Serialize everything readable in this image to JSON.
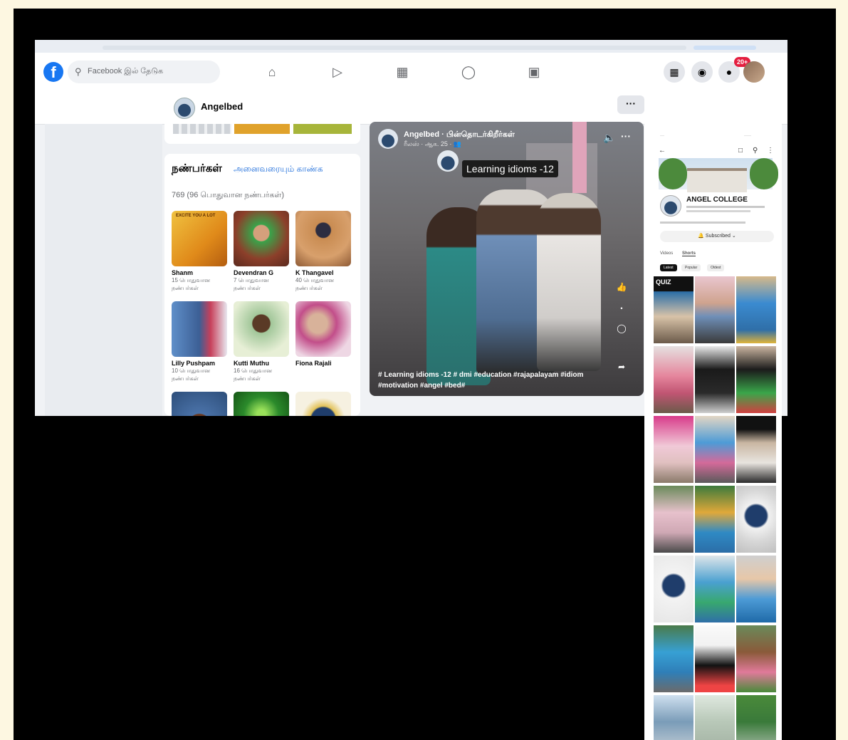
{
  "search": {
    "placeholder": "Facebook இல் தேடுக"
  },
  "badge": "20+",
  "page": {
    "name": "Angelbed"
  },
  "friends": {
    "title": "நண்பர்கள்",
    "see_all": "அனைவரையும் காண்க",
    "count": "769 (96 பொதுவான நண்பர்கள்)",
    "items": [
      {
        "name": "Shanm",
        "mutual": "15 பொதுவான நண்பர்கள்"
      },
      {
        "name": "Devendran G",
        "mutual": "7 பொதுவான நண்பர்கள்"
      },
      {
        "name": "K Thangavel",
        "mutual": "40 பொதுவான நண்பர்கள்"
      },
      {
        "name": "Lilly Pushpam",
        "mutual": "10 பொதுவான நண்பர்கள்"
      },
      {
        "name": "Kutti Muthu",
        "mutual": "16 பொதுவான நண்பர்கள்"
      },
      {
        "name": "Fiona Rajali",
        "mutual": ""
      }
    ],
    "card1_text": "EXCITE YOU A LOT"
  },
  "post": {
    "author": "Angelbed · பின்தொடர்கிறீர்கள்",
    "meta": "ரீலஸ் · ஆக. 25 · 👥",
    "overlay": "Learning idioms -12",
    "caption": "# Learning idioms -12 # dmi #education #rajapalayam #idiom #motivation #angel #bed#"
  },
  "phone": {
    "channel": "ANGEL COLLEGE",
    "subscribe": "Subscribed",
    "tabs": [
      "Videos",
      "Shorts"
    ],
    "chips": [
      "Latest",
      "Popular",
      "Oldest"
    ],
    "quiz": "QUIZ"
  },
  "colors": {
    "brand": "#1877f2",
    "link": "#216fdb",
    "notification": "#e41e3f"
  }
}
